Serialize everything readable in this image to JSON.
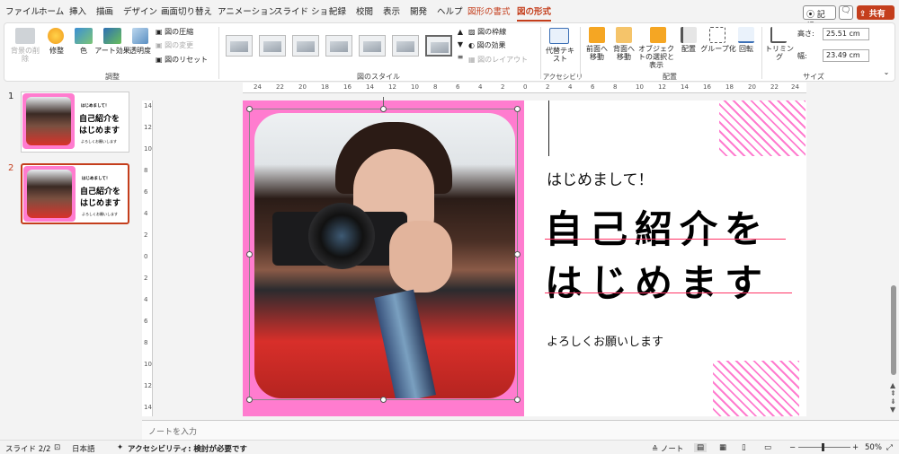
{
  "tabs": [
    "ファイル",
    "ホーム",
    "挿入",
    "描画",
    "デザイン",
    "画面切り替え",
    "アニメーション",
    "スライド ショー",
    "記録",
    "校閲",
    "表示",
    "開発",
    "ヘルプ",
    "図形の書式",
    "図の形式"
  ],
  "topright": {
    "record": "記録",
    "share": "共有"
  },
  "ribbon": {
    "bg_remove": "背景の削除",
    "adjust": "修整",
    "color": "色",
    "art": "アート効果",
    "transp": "透明度",
    "compress": "図の圧縮",
    "change": "図の変更",
    "reset": "図のリセット",
    "grp_adjust": "調整",
    "grp_style": "図のスタイル",
    "border": "図の枠線",
    "effect": "図の効果",
    "layout": "図のレイアウト",
    "alt": "代替テキスト",
    "grp_access": "アクセシビリティ",
    "forward": "前面へ移動",
    "backward": "背面へ移動",
    "select_pane": "オブジェクトの選択と表示",
    "align": "配置",
    "group": "グループ化",
    "rotate": "回転",
    "grp_arrange": "配置",
    "crop": "トリミング",
    "height_label": "高さ:",
    "height": "25.51 cm",
    "width_label": "幅:",
    "width": "23.49 cm",
    "grp_size": "サイズ"
  },
  "ruler_h": [
    "24",
    "22",
    "20",
    "18",
    "16",
    "14",
    "12",
    "10",
    "8",
    "6",
    "4",
    "2",
    "0",
    "2",
    "4",
    "6",
    "8",
    "10",
    "12",
    "14",
    "16",
    "18",
    "20",
    "22",
    "24"
  ],
  "ruler_v": [
    "14",
    "12",
    "10",
    "8",
    "6",
    "4",
    "2",
    "0",
    "2",
    "4",
    "6",
    "8",
    "10",
    "12",
    "14"
  ],
  "slides": [
    {
      "num": "1"
    },
    {
      "num": "2"
    }
  ],
  "thumb": {
    "greet": "はじめまして！",
    "l1": "自己紹介を",
    "l2": "はじめます",
    "closing": "よろしくお願いします"
  },
  "slide": {
    "greet": "はじめまして！",
    "line1": "自己紹介を",
    "line2": "はじめます",
    "closing": "よろしくお願いします"
  },
  "notes": "ノートを入力",
  "status": {
    "slide": "スライド 2/2",
    "lang": "日本語",
    "access": "アクセシビリティ: 検討が必要です",
    "notes": "ノート",
    "zoom": "50%"
  },
  "colors": {
    "accent": "#c43e1c",
    "pink": "#ff7ccf"
  }
}
